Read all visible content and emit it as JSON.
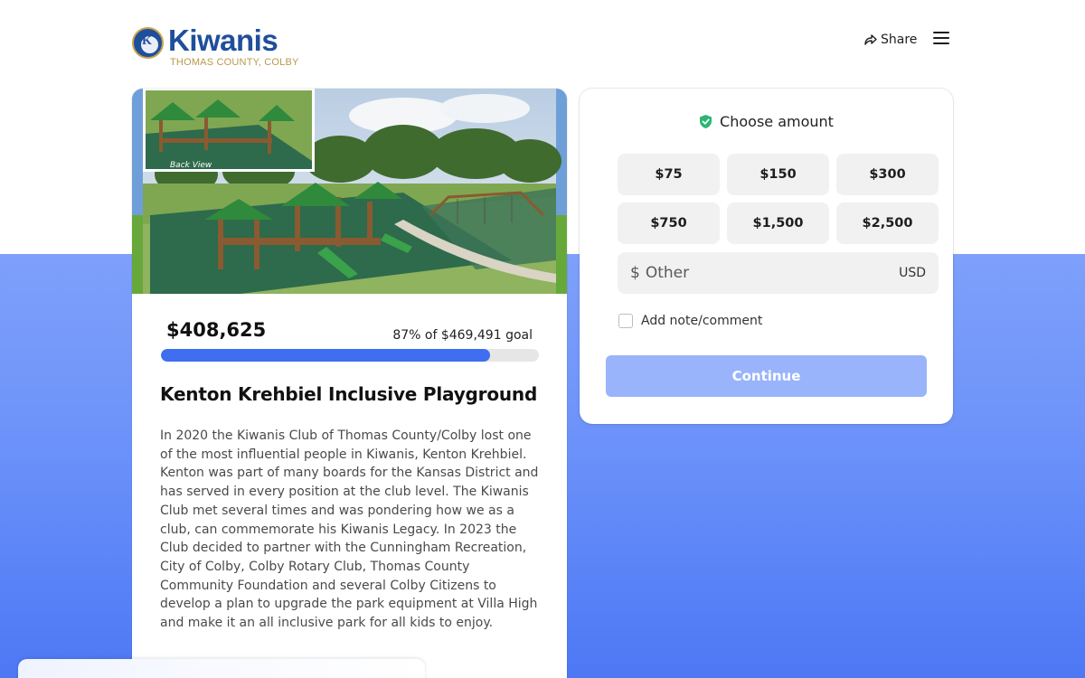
{
  "brand": {
    "name": "Kiwanis",
    "seal_letter": "K",
    "subtitle": "THOMAS COUNTY, COLBY",
    "color": "#1f4f9b",
    "accent": "#b99a4a"
  },
  "header": {
    "share_label": "Share",
    "share_icon": "share-arrow-icon",
    "menu_icon": "hamburger-menu-icon"
  },
  "campaign": {
    "image_label": "Back View",
    "raised": "$408,625",
    "goal_text": "87% of $469,491 goal",
    "progress_percent": 87,
    "title": "Kenton Krehbiel Inclusive Playground",
    "description": "In 2020 the Kiwanis Club of Thomas County/Colby lost one of the most influential people in Kiwanis, Kenton Krehbiel. Kenton was part of many boards for the Kansas District and has served in every position at the club level. The Kiwanis Club met several times and was pondering how we as a club, can commemorate his Kiwanis Legacy. In 2023 the Club decided to partner with the Cunningham Recreation, City of Colby, Colby Rotary Club, Thomas County Community Foundation and several Colby Citizens to develop a plan to upgrade the park equipment at Villa High and make it an all inclusive park for all kids to enjoy."
  },
  "donate": {
    "heading": "Choose amount",
    "heading_icon": "shield-check-icon",
    "amounts": [
      "$75",
      "$150",
      "$300",
      "$750",
      "$1,500",
      "$2,500"
    ],
    "other_symbol": "$",
    "other_placeholder": "Other",
    "currency": "USD",
    "note_label": "Add note/comment",
    "continue_label": "Continue",
    "accent": "#3f6ff0",
    "button_color": "#9ab4fb"
  }
}
